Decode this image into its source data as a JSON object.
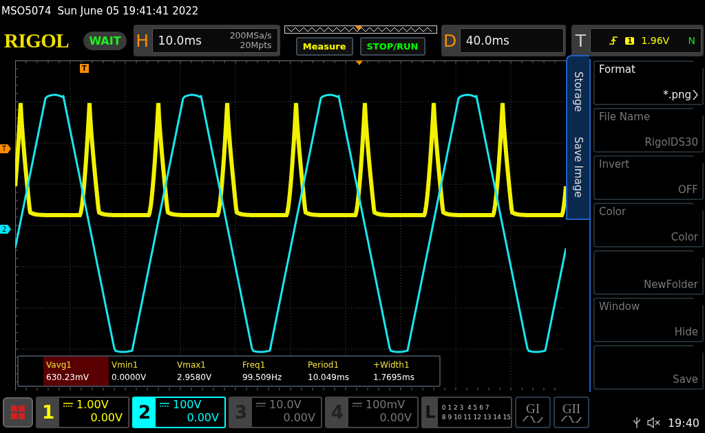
{
  "status_line": {
    "model": "MSO5074",
    "datetime": "Sun June 05 19:41:41 2022"
  },
  "toolbar": {
    "logo": "RIGOL",
    "run_state": "WAIT",
    "horizontal": {
      "label": "H",
      "timebase": "10.0ms",
      "sample_rate": "200MSa/s",
      "memory_depth": "20Mpts"
    },
    "buttons": [
      {
        "label": "Measure",
        "color": "#ffff00"
      },
      {
        "label": "STOP/RUN",
        "color": "#00ff00"
      }
    ],
    "delay": {
      "label": "D",
      "value": "40.0ms"
    },
    "trigger": {
      "label": "T",
      "source": "1",
      "level": "1.96V",
      "coupling": "N"
    }
  },
  "screen": {
    "trigger_position_marker": "T",
    "level_markers": [
      {
        "label": "T",
        "color": "#ff8c00"
      },
      {
        "label": "2",
        "color": "#00e5ff"
      }
    ]
  },
  "measurements": [
    {
      "name": "Vavg1",
      "value": "630.23mV",
      "selected": true
    },
    {
      "name": "Vmin1",
      "value": "0.0000V",
      "selected": false
    },
    {
      "name": "Vmax1",
      "value": "2.9580V",
      "selected": false
    },
    {
      "name": "Freq1",
      "value": "99.509Hz",
      "selected": false
    },
    {
      "name": "Period1",
      "value": "10.049ms",
      "selected": false
    },
    {
      "name": "+Width1",
      "value": "1.7695ms",
      "selected": false
    }
  ],
  "side_menu": {
    "tabs": [
      {
        "label": "Storage"
      },
      {
        "label": "Save Image"
      }
    ],
    "items": [
      {
        "label": "Format",
        "value": "*.png",
        "disabled": false,
        "submenu": true
      },
      {
        "label": "File Name",
        "value": "RigolDS30",
        "disabled": true,
        "submenu": false
      },
      {
        "label": "Invert",
        "value": "OFF",
        "disabled": true,
        "submenu": false
      },
      {
        "label": "Color",
        "value": "Color",
        "disabled": true,
        "submenu": false
      },
      {
        "value": "NewFolder",
        "disabled": true,
        "submenu": false
      },
      {
        "label": "Window",
        "value": "Hide",
        "disabled": true,
        "submenu": false
      },
      {
        "value": "Save",
        "disabled": true,
        "submenu": false
      }
    ]
  },
  "channels": [
    {
      "number": "1",
      "scale": "1.00V",
      "offset": "0.00V",
      "color": "#ffff00",
      "on": true,
      "selected": false
    },
    {
      "number": "2",
      "scale": "100V",
      "offset": "0.00V",
      "color": "#00ffff",
      "on": true,
      "selected": true
    },
    {
      "number": "3",
      "scale": "10.0V",
      "offset": "0.00V",
      "on": false,
      "selected": false
    },
    {
      "number": "4",
      "scale": "100mV",
      "offset": "0.00V",
      "on": false,
      "selected": false
    }
  ],
  "logic": {
    "label": "L",
    "rows": [
      "0 1 2 3  4 5 6 7",
      "8 9 10 11 12 13 14 15"
    ]
  },
  "generators": [
    {
      "label": "GI"
    },
    {
      "label": "GII"
    }
  ],
  "status_bar": {
    "time": "19:40"
  }
}
